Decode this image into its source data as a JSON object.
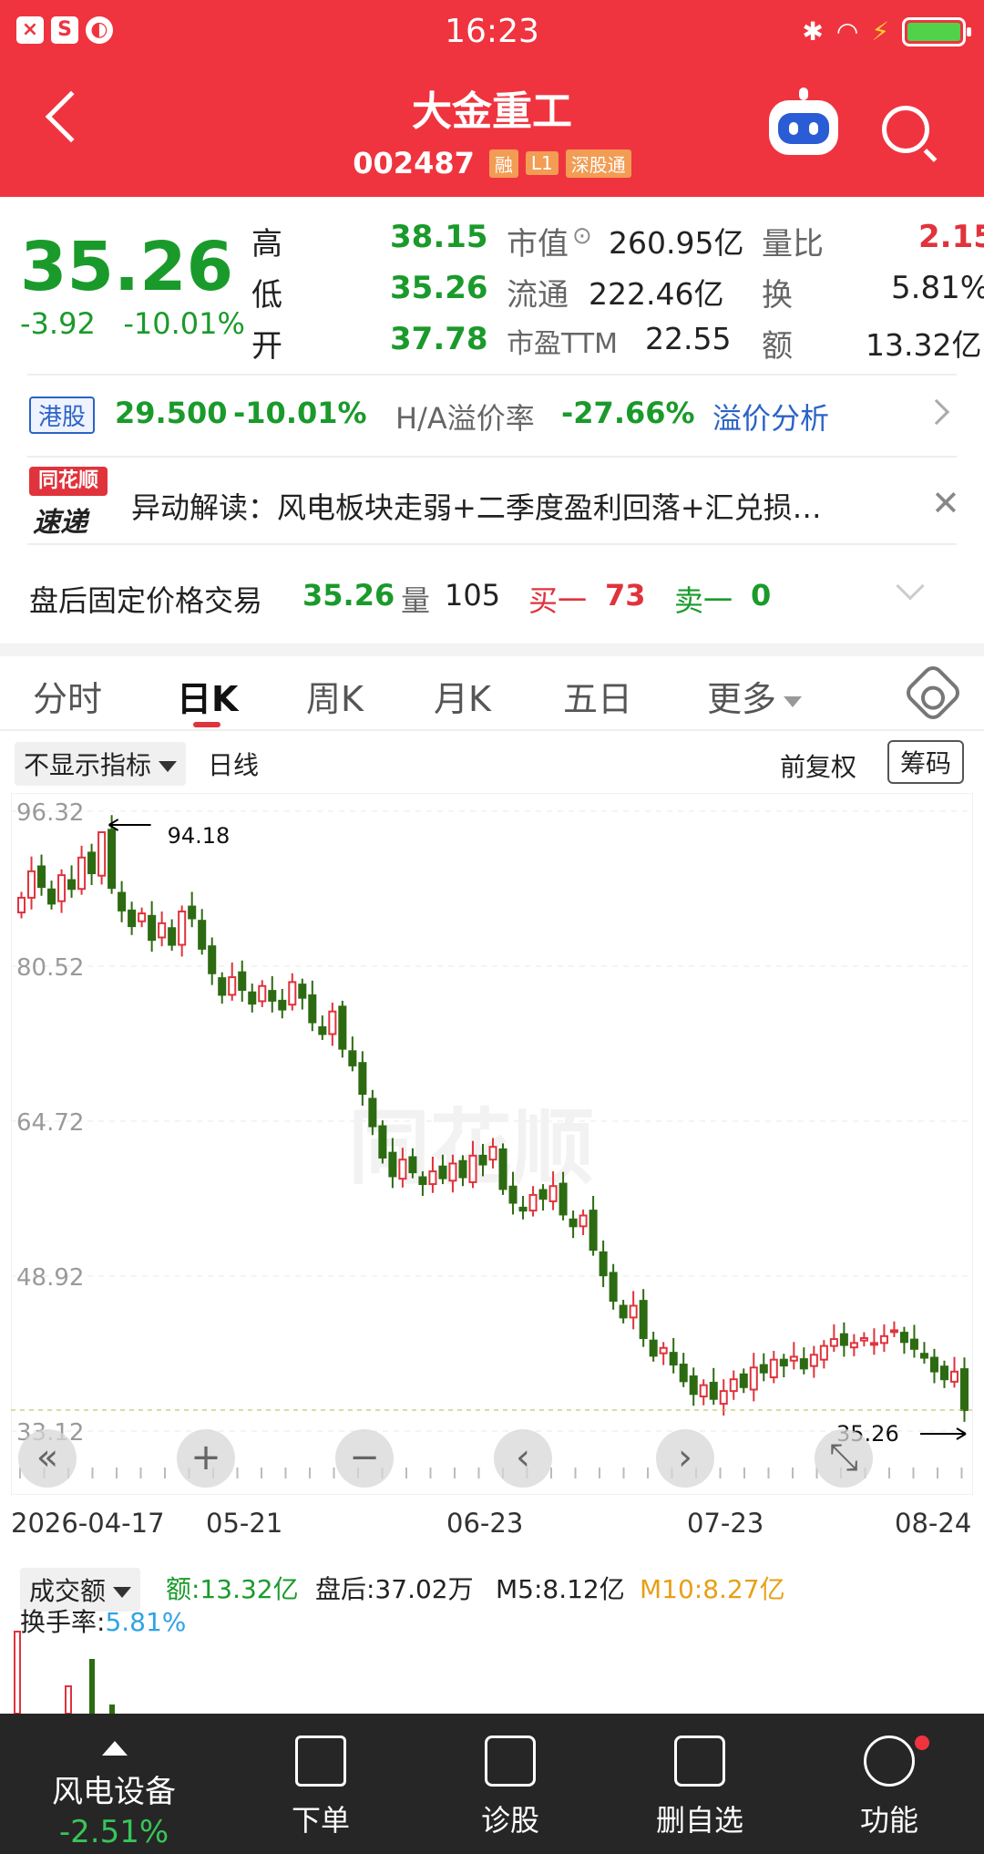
{
  "status": {
    "time": "16:23"
  },
  "header": {
    "title": "大金重工",
    "code": "002487",
    "tags": [
      "融",
      "L1",
      "深股通"
    ]
  },
  "quote": {
    "price": "35.26",
    "change": "-3.92",
    "change_pct": "-10.01%",
    "high_label": "高",
    "high": "38.15",
    "low_label": "低",
    "low": "35.26",
    "open_label": "开",
    "open": "37.78",
    "mcap_label": "市值",
    "mcap": "260.95亿",
    "float_label": "流通",
    "float": "222.46亿",
    "pe_label": "市盈TTM",
    "pe": "22.55",
    "vr_label": "量比",
    "vr": "2.15",
    "turn_label": "换",
    "turn": "5.81%",
    "amount_label": "额",
    "amount": "13.32亿"
  },
  "hk": {
    "tag": "港股",
    "price": "29.500",
    "pct": "-10.01%",
    "premium_label": "H/A溢价率",
    "premium": "-27.66%",
    "link": "溢价分析"
  },
  "news": {
    "logo_top": "同花顺",
    "logo_bottom": "速递",
    "text": "异动解读：风电板块走弱+二季度盈利回落+汇兑损…"
  },
  "after_hours": {
    "label": "盘后固定价格交易",
    "price": "35.26",
    "vol_label": "量",
    "vol": "105",
    "buy_label": "买一",
    "buy": "73",
    "sell_label": "卖一",
    "sell": "0"
  },
  "tabs": [
    "分时",
    "日K",
    "周K",
    "月K",
    "五日",
    "更多"
  ],
  "toolbar": {
    "indicator": "不显示指标",
    "line_type": "日线",
    "adjust": "前复权",
    "chips": "筹码"
  },
  "chart_data": {
    "type": "candlestick",
    "y_ticks": [
      "96.32",
      "80.52",
      "64.72",
      "48.92",
      "33.12"
    ],
    "ylim": [
      33.12,
      96.32
    ],
    "x_labels": [
      "2026-04-17",
      "05-21",
      "06-23",
      "07-23",
      "08-24"
    ],
    "max_marker": "94.18",
    "last_marker": "35.26",
    "watermark": "同花顺",
    "closes": [
      87.5,
      90.2,
      88.6,
      86.9,
      89.8,
      88.4,
      91.6,
      90.0,
      94.18,
      88.5,
      86.2,
      84.6,
      85.9,
      83.2,
      84.9,
      82.7,
      86.1,
      85.4,
      82.3,
      79.8,
      77.6,
      79.4,
      78.1,
      76.7,
      78.5,
      77.0,
      76.1,
      78.9,
      77.3,
      74.8,
      73.6,
      75.9,
      72.1,
      70.4,
      67.5,
      64.2,
      61.0,
      59.1,
      60.8,
      59.5,
      58.3,
      59.6,
      58.9,
      60.4,
      59.0,
      61.2,
      60.3,
      62.1,
      57.8,
      56.4,
      55.6,
      57.2,
      56.8,
      58.1,
      55.2,
      54.0,
      55.1,
      51.6,
      49.0,
      46.4,
      44.7,
      45.9,
      42.6,
      40.8,
      41.6,
      39.9,
      38.2,
      36.9,
      37.8,
      36.4,
      37.2,
      38.4,
      37.6,
      39.6,
      39.1,
      40.4,
      39.8,
      40.7,
      39.5,
      40.9,
      41.8,
      42.5,
      41.9,
      42.1,
      42.6,
      42.1,
      42.8,
      43.4,
      42.2,
      41.5,
      40.6,
      39.2,
      38.4,
      39.18,
      35.26
    ],
    "volume_label": "成交额",
    "volume_amount": "额:13.32亿",
    "after_hours": "盘后:37.02万",
    "m5": "M5:8.12亿",
    "m10": "M10:8.27亿",
    "turnover_label": "换手率:",
    "turnover": "5.81%"
  },
  "colors": {
    "up": "#e0333c",
    "down": "#2d6b12",
    "header": "#ef343f"
  },
  "bottom": {
    "sector": "风电设备",
    "sector_pct": "-2.51%",
    "items": [
      "下单",
      "诊股",
      "删自选",
      "功能"
    ]
  }
}
